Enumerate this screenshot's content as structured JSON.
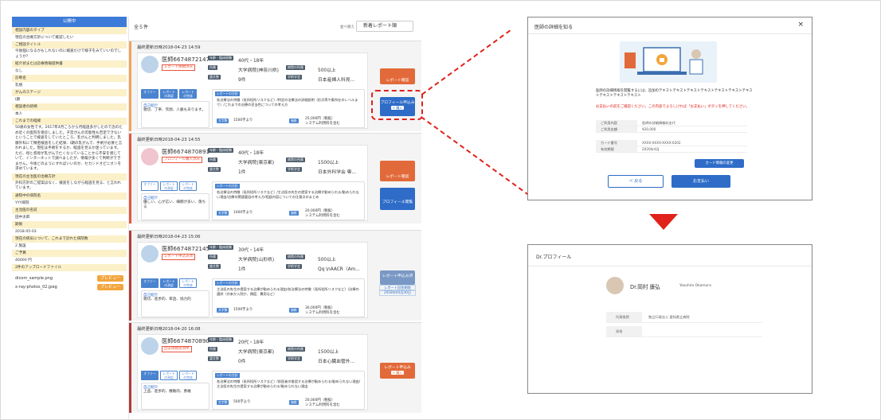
{
  "left_panel": {
    "header": "公開中",
    "rows": [
      {
        "t": "相談内容のタイプ",
        "c": "y"
      },
      {
        "t": "現在の治療方針について確認したい",
        "c": "w"
      },
      {
        "t": "ご相談タイトル",
        "c": "y"
      },
      {
        "t": "今後個になるかもしれないのに検査だけで様子をみていいのでしょうか？",
        "c": "w",
        "m": true
      },
      {
        "t": "紹介状または診療情報提供書",
        "c": "y"
      },
      {
        "t": "なし",
        "c": "w"
      },
      {
        "t": "診断名",
        "c": "y"
      },
      {
        "t": "乳癌",
        "c": "w"
      },
      {
        "t": "がんのステージ",
        "c": "y"
      },
      {
        "t": "I期",
        "c": "w"
      },
      {
        "t": "相談者の続柄",
        "c": "y"
      },
      {
        "t": "本人",
        "c": "w"
      },
      {
        "t": "これまでの経緯",
        "c": "y"
      },
      {
        "t": "50歳の女性です。2017年4月ころから月経過多がしたので念のため近くの医院を受診しました。子宮がんの可能性も否定できないということで検査をしていたところ、乳がんと判明しました。乳腺外科にて精密検査をした結果、I期の乳がんで、手術が必要と言われました。現在は手術をするか、経過を見るか迷っています。ただ、母と叔母が乳がんで亡くなっていることから不安を感じていて、インターネットで調べましたが、情報が多くて判断ができません。今後どのようにすればいいのか、セカンドオピニオンを求めています。",
        "c": "w",
        "m": true
      },
      {
        "t": "現在の主治医の治療方針",
        "c": "y"
      },
      {
        "t": "外科方針のご提案はなく、検査をしながら経過を見る、と言われています。",
        "c": "w",
        "m": true
      },
      {
        "t": "通院中の病院名",
        "c": "y"
      },
      {
        "t": "YYY病院",
        "c": "w"
      },
      {
        "t": "主治医の名前",
        "c": "y"
      },
      {
        "t": "田中太郎",
        "c": "w"
      },
      {
        "t": "期限",
        "c": "y"
      },
      {
        "t": "2018-05-03",
        "c": "w"
      },
      {
        "t": "現在の病気について、これまで診れた病院数",
        "c": "y"
      },
      {
        "t": "2 施設",
        "c": "w"
      },
      {
        "t": "ご予算",
        "c": "y"
      },
      {
        "t": "40000 円",
        "c": "w"
      },
      {
        "t": "2件のアップロードファイル",
        "c": "y"
      }
    ],
    "files": [
      {
        "name": "dicom_sample.png",
        "btn": "プレビュー"
      },
      {
        "name": "x-ray-photos_02.jpeg",
        "btn": "プレビュー"
      }
    ]
  },
  "list": {
    "count": "全５件",
    "sort_label": "並べ替え",
    "sort_value": "新着レポート順",
    "cards": [
      {
        "date": "最終更新日時2018-04-23 14:59",
        "bar": "#f0a35a",
        "av": "b",
        "name": "医師6674872147",
        "tag": "レポート依頼済み",
        "chips": [
          "年齢・臨床経験",
          "所属",
          "論文数",
          "病院の所属",
          "学術学会"
        ],
        "age": "40代・18年",
        "hosp": "大学病院(神奈川県)",
        "papers": "9件",
        "cases": "500以上",
        "society": "日本産婦人科見...",
        "steps": [
          "オファー",
          "レポートの承認",
          "レポートの完成"
        ],
        "step_on": 2,
        "intro_h": "自己紹介",
        "intro": "親切、丁寧、笑顔、人脈もあります。",
        "d_lab": "レポートの方針",
        "d_txt": "各治療法の特徴（長所短所リスクなど）/特定の治療法の詳細説明（形式等や素所在のレベルまで）/これまでの治療の妥当性についての考え方",
        "wc_lab": "文字数",
        "wc": "1500字より",
        "fee_lab": "価格",
        "fee": "25,000円（税抜）",
        "fee2": "システム利用料を含む",
        "btn1": "レポート確認",
        "btn2": "プロフィール申込み",
        "plus": "+ 購入"
      },
      {
        "date": "最終更新日時2018-04-23 14:55",
        "bar": "#e8553e",
        "av": "p",
        "name": "医師6674870891",
        "tag": "プロフィール購入済み",
        "chips": [
          "年齢・臨床経験",
          "所属",
          "論文数",
          "病院の所属",
          "学術学会"
        ],
        "age": "40代・18年",
        "hosp": "大学病院(東京都)",
        "papers": "1件",
        "cases": "1500以上",
        "society": "日本外科学会 専...",
        "steps": [
          "オファー",
          "レポートの承認",
          "レポートの完成"
        ],
        "step_on": -1,
        "intro_h": "自己紹介",
        "intro": "優しい、心が広い、細腕が多い、落ちる",
        "d_lab": "レポートの方針",
        "d_txt": "各治療法の特徴（長所短所リスクなど）/主治医の先生の提案する治療が勧められる/勧められない理由/治療の関連要因の考え方/相談内容についての注意点のまとめ",
        "wc_lab": "文字数",
        "wc": "1000字より",
        "fee_lab": "価格",
        "fee": "20,000円（税抜）",
        "fee2": "システム利用料を含む",
        "btn1": "レポート確認",
        "btn2": "プロフィール閲覧",
        "plus": ""
      },
      {
        "date": "最終更新日時2018-04-23 15:06",
        "bar": "#b13a3a",
        "av": "b",
        "name": "医師6674872145",
        "tag": "レポート申込み済",
        "chips": [
          "年齢・臨床経験",
          "所属",
          "論文数",
          "病院の所属",
          "学術学会"
        ],
        "age": "30代・14年",
        "hosp": "大学病院(山形県)",
        "papers": "1件",
        "cases": "500以上",
        "society": "Qq \\nAACR（Am...",
        "steps": [
          "オファー",
          "レポートの承認",
          "レポートの完成"
        ],
        "step_on": 1,
        "intro_h": "自己紹介",
        "intro": "親切、進歩的、率直、協力的",
        "d_lab": "レポートの方針",
        "d_txt": "主治医の先生の提案する治療が勧められる理由/各治療法の特徴（長所短所リスクなど）/治療の選択（外来か入院か、頻度、費用など）",
        "wc_lab": "文字数",
        "wc": "1500字より",
        "fee_lab": "価格",
        "fee": "30,000円（税抜）",
        "fee2": "システム利用料を含む",
        "btn1": "レポート申込み済",
        "btn2": "",
        "plus": "",
        "end1": "レポート回答期限",
        "end2": "2018年04月30日"
      },
      {
        "date": "最終更新日時2018-04-20 16:08",
        "bar": "#b13a3a",
        "av": "b",
        "name": "医師6674870890",
        "tag": "回答依頼受領中",
        "chips": [
          "年齢・臨床経験",
          "所属",
          "論文数",
          "病院の所属",
          "学術学会"
        ],
        "age": "20代・18年",
        "hosp": "大学病院(東京都)",
        "papers": "0件",
        "cases": "1500以上",
        "society": "日本心臓血管外...",
        "steps": [
          "オファー",
          "レポートの承認",
          "レポートの完成"
        ],
        "step_on": 0,
        "intro_h": "自己紹介",
        "intro": "上品、進歩的、機敏的、勇敢",
        "d_lab": "レポートの方針",
        "d_txt": "各治療法の特徴（長所短所リスクなど）/前医者の推奨する治療が勧められる/勧められない理由/主治医の先生の提案する治療が勧められる/勧められない理由",
        "wc_lab": "文字数",
        "wc": "500字より",
        "fee_lab": "価格",
        "fee": "20,000円（税抜）",
        "fee2": "システム利用料を含む",
        "btn1": "レポート申込み",
        "btn2": "",
        "plus": "+ 購入"
      }
    ]
  },
  "modal": {
    "title": "医師の詳細を知る",
    "close": "×",
    "desc": "医師の詳細情報を閲覧するには、追加のテキストテキストテキストテキストテキストテキストテキストテキストテキストテキスト",
    "warn": "お支払いの前をご確認ください。この内容でよろしければ「お支払い」ボタンを押してください。",
    "rows1": [
      {
        "k": "ご利用内容",
        "v": "医師の詳細情報料金代"
      },
      {
        "k": "ご利用金額",
        "v": "¥20,000"
      }
    ],
    "rows2": [
      {
        "k": "カード番号",
        "v": "XXXX-XXXX-XXXX-0202"
      },
      {
        "k": "有効期限",
        "v": "2020年4月"
      }
    ],
    "card_btn": "カード情報の変更",
    "back": "＜ 戻る",
    "pay": "お支払い"
  },
  "profile": {
    "title": "Dr.プロフィール",
    "name": "Dr.岡村 康弘",
    "name_en": "Yasuhiro Okamura",
    "rows": [
      {
        "k": "所属機関",
        "v": "独立行政法人 愛知県立病院"
      },
      {
        "k": "資格",
        "v": ""
      }
    ]
  },
  "colors": {
    "accent": "#2e6cc8",
    "orange": "#e26a3a",
    "red": "#e0221b",
    "panel_head": "#3d7bd8"
  }
}
